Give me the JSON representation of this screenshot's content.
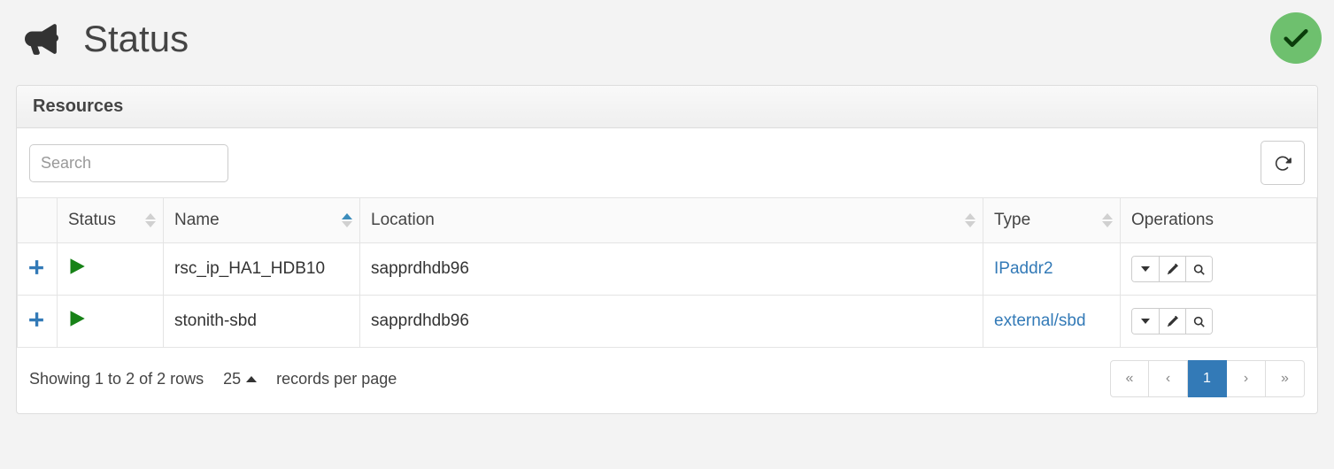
{
  "page": {
    "title": "Status"
  },
  "panel": {
    "title": "Resources",
    "search_placeholder": "Search"
  },
  "columns": {
    "status": "Status",
    "name": "Name",
    "location": "Location",
    "type": "Type",
    "operations": "Operations"
  },
  "rows": [
    {
      "name": "rsc_ip_HA1_HDB10",
      "location": "sapprdhdb96",
      "type": "IPaddr2"
    },
    {
      "name": "stonith-sbd",
      "location": "sapprdhdb96",
      "type": "external/sbd"
    }
  ],
  "footer": {
    "summary": "Showing 1 to 2 of 2 rows",
    "page_size": "25",
    "per_page_label": "records per page",
    "current_page": "1"
  }
}
